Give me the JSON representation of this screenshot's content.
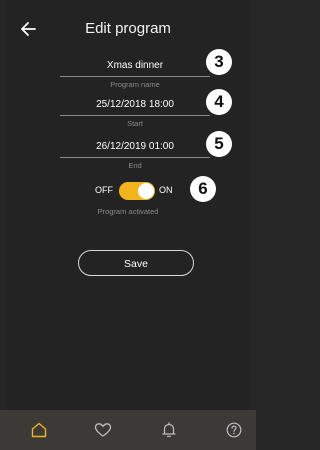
{
  "header": {
    "title": "Edit program",
    "back_icon": "arrow-left-icon"
  },
  "form": {
    "program_name": {
      "value": "Xmas dinner",
      "label": "Program name"
    },
    "start": {
      "value": "25/12/2018 18:00",
      "label": "Start"
    },
    "end": {
      "value": "26/12/2019 01:00",
      "label": "End"
    },
    "activation": {
      "off_label": "OFF",
      "on_label": "ON",
      "state": "on",
      "label": "Program activated"
    },
    "save_label": "Save"
  },
  "callouts": [
    "3",
    "4",
    "5",
    "6"
  ],
  "bottom_nav": [
    {
      "icon": "home-icon",
      "active": true
    },
    {
      "icon": "heart-icon",
      "active": false
    },
    {
      "icon": "bell-icon",
      "active": false
    },
    {
      "icon": "help-icon",
      "active": false
    }
  ],
  "colors": {
    "accent": "#f3b41b",
    "background": "#232323",
    "nav_bg": "#3b3a37",
    "muted_text": "#8b8b8b"
  }
}
